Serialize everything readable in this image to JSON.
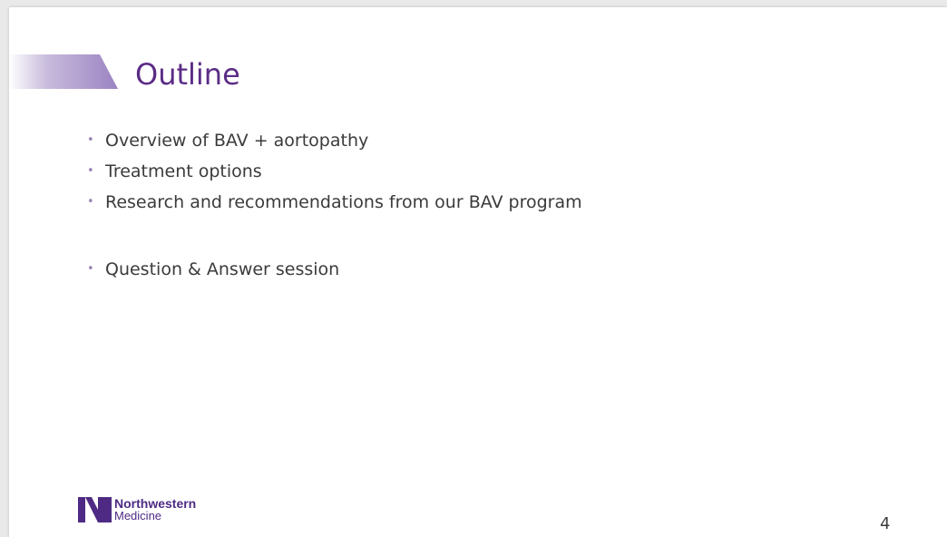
{
  "slide": {
    "title": "Outline",
    "bullets": [
      "Overview of BAV + aortopathy",
      "Treatment options",
      "Research and recommendations from our BAV program",
      "Question & Answer session"
    ],
    "bullet_glyph": "•",
    "page_number": "4"
  },
  "logo": {
    "line1": "Northwestern",
    "line2": "Medicine"
  },
  "colors": {
    "title": "#5b2c86",
    "banner_start": "#ffffff",
    "banner_end": "#9b83c2",
    "bullet": "#9a85b5",
    "brand": "#4e2a84"
  },
  "icons": {
    "logo_mark": "northwestern-n-logo-icon"
  }
}
